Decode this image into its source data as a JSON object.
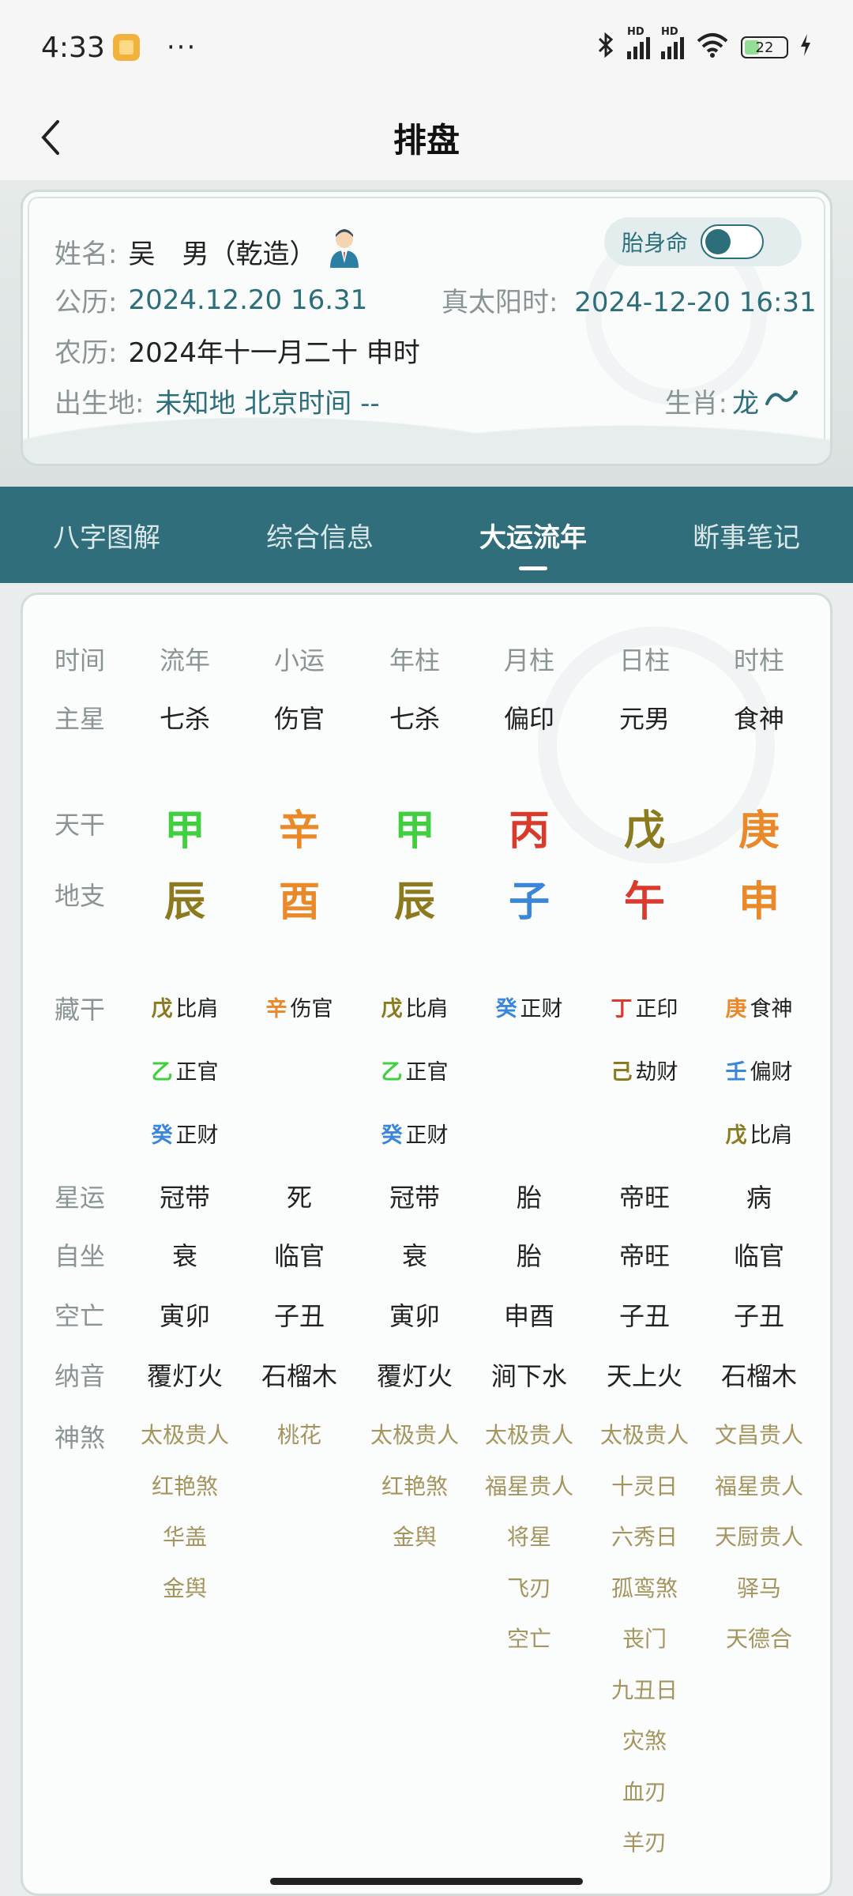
{
  "status_bar": {
    "time": "4:33",
    "dots": "···",
    "battery": "22",
    "hd1": "HD",
    "hd2": "HD"
  },
  "header": {
    "title": "排盘"
  },
  "info": {
    "name_label": "姓名:",
    "name_value": "吴　男（乾造）",
    "solar_label": "公历:",
    "solar_value": "2024.12.20 16.31",
    "true_solar_label": "真太阳时:",
    "true_solar_value": "2024-12-20 16:31",
    "lunar_label": "农历:",
    "lunar_value": "2024年十一月二十 申时",
    "place_label": "出生地:",
    "place_value": "未知地 北京时间 --",
    "zodiac_label": "生肖:",
    "zodiac_value": "龙",
    "toggle_label": "胎身命"
  },
  "tabs": [
    {
      "label": "八字图解"
    },
    {
      "label": "综合信息"
    },
    {
      "label": "大运流年"
    },
    {
      "label": "断事笔记"
    }
  ],
  "table": {
    "headers": [
      "时间",
      "流年",
      "小运",
      "年柱",
      "月柱",
      "日柱",
      "时柱"
    ],
    "row_labels": {
      "zhuxing": "主星",
      "tiangan": "天干",
      "dizhi": "地支",
      "canggan": "藏干",
      "xingyun": "星运",
      "zizuo": "自坐",
      "kongwang": "空亡",
      "nayin": "纳音",
      "shensha": "神煞"
    },
    "zhuxing": [
      "七杀",
      "伤官",
      "七杀",
      "偏印",
      "元男",
      "食神"
    ],
    "tiangan": [
      "甲",
      "辛",
      "甲",
      "丙",
      "戊",
      "庚"
    ],
    "tiangan_colors": [
      "#3fcf3f",
      "#e9892a",
      "#3fcf3f",
      "#d93a2b",
      "#8c7a1e",
      "#e9892a"
    ],
    "dizhi": [
      "辰",
      "酉",
      "辰",
      "子",
      "午",
      "申"
    ],
    "dizhi_colors": [
      "#8c7a1e",
      "#e9892a",
      "#8c7a1e",
      "#3a86d8",
      "#d93a2b",
      "#e9892a"
    ],
    "canggan": [
      [
        {
          "g": "戊",
          "c": "#8c7a1e",
          "s": "比肩"
        },
        {
          "g": "乙",
          "c": "#3fcf3f",
          "s": "正官"
        },
        {
          "g": "癸",
          "c": "#3a86d8",
          "s": "正财"
        }
      ],
      [
        {
          "g": "辛",
          "c": "#e9892a",
          "s": "伤官"
        }
      ],
      [
        {
          "g": "戊",
          "c": "#8c7a1e",
          "s": "比肩"
        },
        {
          "g": "乙",
          "c": "#3fcf3f",
          "s": "正官"
        },
        {
          "g": "癸",
          "c": "#3a86d8",
          "s": "正财"
        }
      ],
      [
        {
          "g": "癸",
          "c": "#3a86d8",
          "s": "正财"
        }
      ],
      [
        {
          "g": "丁",
          "c": "#d93a2b",
          "s": "正印"
        },
        {
          "g": "己",
          "c": "#8c7a1e",
          "s": "劫财"
        }
      ],
      [
        {
          "g": "庚",
          "c": "#e9892a",
          "s": "食神"
        },
        {
          "g": "壬",
          "c": "#3a86d8",
          "s": "偏财"
        },
        {
          "g": "戊",
          "c": "#8c7a1e",
          "s": "比肩"
        }
      ]
    ],
    "xingyun": [
      "冠带",
      "死",
      "冠带",
      "胎",
      "帝旺",
      "病"
    ],
    "zizuo": [
      "衰",
      "临官",
      "衰",
      "胎",
      "帝旺",
      "临官"
    ],
    "kongwang": [
      "寅卯",
      "子丑",
      "寅卯",
      "申酉",
      "子丑",
      "子丑"
    ],
    "nayin": [
      "覆灯火",
      "石榴木",
      "覆灯火",
      "涧下水",
      "天上火",
      "石榴木"
    ],
    "shensha": [
      [
        "太极贵人",
        "红艳煞",
        "华盖",
        "金舆"
      ],
      [
        "桃花"
      ],
      [
        "太极贵人",
        "红艳煞",
        "金舆"
      ],
      [
        "太极贵人",
        "福星贵人",
        "将星",
        "飞刃",
        "空亡"
      ],
      [
        "太极贵人",
        "十灵日",
        "六秀日",
        "孤鸾煞",
        "丧门",
        "九丑日",
        "灾煞",
        "血刃",
        "羊刃"
      ],
      [
        "文昌贵人",
        "福星贵人",
        "天厨贵人",
        "驿马",
        "天德合"
      ]
    ]
  }
}
